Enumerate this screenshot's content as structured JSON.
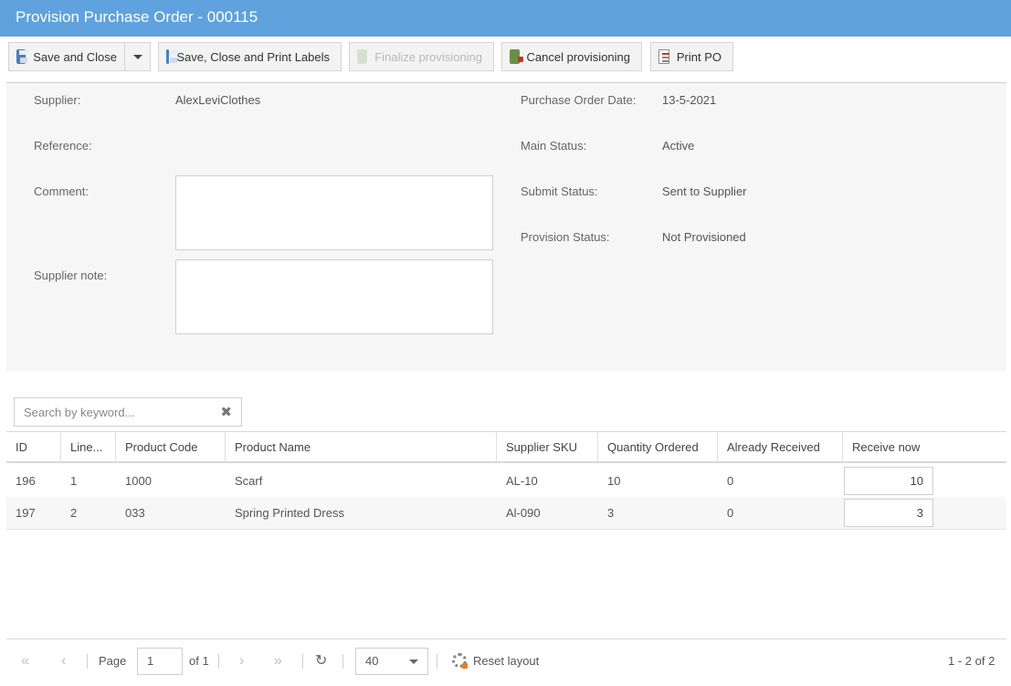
{
  "window": {
    "title": "Provision Purchase Order - 000115"
  },
  "toolbar": {
    "save_close": "Save and Close",
    "save_close_print": "Save, Close and Print Labels",
    "finalize": "Finalize provisioning",
    "cancel": "Cancel provisioning",
    "print_po": "Print PO"
  },
  "form": {
    "supplier_label": "Supplier:",
    "supplier_value": "AlexLeviClothes",
    "reference_label": "Reference:",
    "reference_value": "",
    "comment_label": "Comment:",
    "comment_value": "",
    "supplier_note_label": "Supplier note:",
    "supplier_note_value": "",
    "po_date_label": "Purchase Order Date:",
    "po_date_value": "13-5-2021",
    "main_status_label": "Main Status:",
    "main_status_value": "Active",
    "submit_status_label": "Submit Status:",
    "submit_status_value": "Sent to Supplier",
    "provision_status_label": "Provision Status:",
    "provision_status_value": "Not Provisioned"
  },
  "search": {
    "placeholder": "Search by keyword..."
  },
  "grid": {
    "columns": [
      "ID",
      "Line...",
      "Product Code",
      "Product Name",
      "Supplier SKU",
      "Quantity Ordered",
      "Already Received",
      "Receive now"
    ],
    "rows": [
      {
        "id": "196",
        "line": "1",
        "code": "1000",
        "name": "Scarf",
        "sku": "AL-10",
        "qty": "10",
        "received": "0",
        "receive_now": "10"
      },
      {
        "id": "197",
        "line": "2",
        "code": "033",
        "name": "Spring Printed Dress",
        "sku": "Al-090",
        "qty": "3",
        "received": "0",
        "receive_now": "3"
      }
    ]
  },
  "pager": {
    "page_label": "Page",
    "page_value": "1",
    "of_label": "of 1",
    "page_size": "40",
    "reset_layout": "Reset layout",
    "summary": "1 - 2 of 2"
  },
  "colors": {
    "titlebar": "#5fa2dd",
    "panel": "#f6f6f6"
  }
}
